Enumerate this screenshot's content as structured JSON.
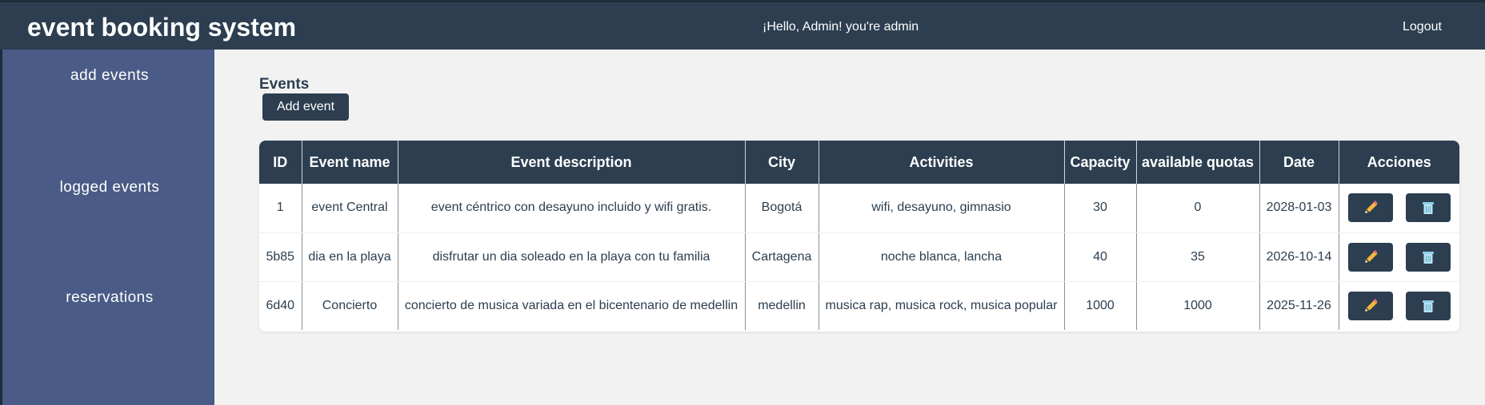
{
  "header": {
    "brand": "event booking system",
    "greeting": "¡Hello, Admin! you're admin",
    "logout_label": "Logout"
  },
  "sidebar": {
    "items": [
      {
        "label": "add events"
      },
      {
        "label": "logged events"
      },
      {
        "label": "reservations"
      }
    ]
  },
  "main": {
    "title": "Events",
    "add_button_label": "Add event",
    "table": {
      "headers": [
        "ID",
        "Event name",
        "Event description",
        "City",
        "Activities",
        "Capacity",
        "available quotas",
        "Date",
        "Acciones"
      ],
      "rows": [
        [
          "1",
          "event Central",
          "event céntrico con desayuno incluido y wifi gratis.",
          "Bogotá",
          "wifi, desayuno, gimnasio",
          "30",
          "0",
          "2028-01-03"
        ],
        [
          "5b85",
          "dia en la playa",
          "disfrutar un dia soleado en la playa con tu familia",
          "Cartagena",
          "noche blanca, lancha",
          "40",
          "35",
          "2026-10-14"
        ],
        [
          "6d40",
          "Concierto",
          "concierto de musica variada en el bicentenario de medellin",
          "medellin",
          "musica rap, musica rock, musica popular",
          "1000",
          "1000",
          "2025-11-26"
        ]
      ],
      "row_actions": [
        "pencil-icon",
        "trash-icon"
      ]
    }
  },
  "colors": {
    "header_bg": "#2c3e50",
    "sidebar_bg": "#495b86",
    "page_bg": "#f2f2f2",
    "accent": "#2c3e50"
  }
}
